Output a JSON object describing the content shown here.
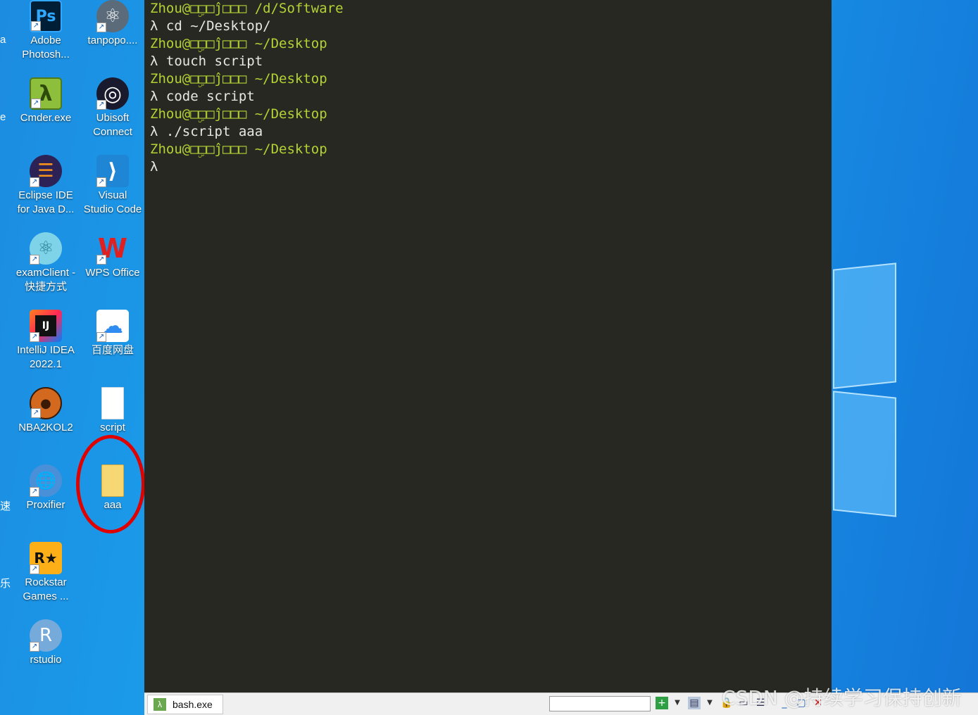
{
  "desktop": {
    "icons": [
      {
        "label": "Adobe\nPhotosh...",
        "icon": "photoshop-icon",
        "color": "#001e36",
        "glyph": "Ps"
      },
      {
        "label": "tanpopo....",
        "icon": "tanpopo-icon",
        "color": "#5b6b7a",
        "glyph": "⚛"
      },
      {
        "label": "Cmder.exe",
        "icon": "cmder-icon",
        "color": "#8dbf3c",
        "glyph": "λ"
      },
      {
        "label": "Ubisoft\nConnect",
        "icon": "ubisoft-icon",
        "color": "#1a1a2e",
        "glyph": "◎"
      },
      {
        "label": "Eclipse IDE\nfor Java D...",
        "icon": "eclipse-icon",
        "color": "#2c2255",
        "glyph": "☰"
      },
      {
        "label": "Visual\nStudio Code",
        "icon": "vscode-icon",
        "color": "#1f86d6",
        "glyph": "⟩"
      },
      {
        "label": "examClient -\n快捷方式",
        "icon": "examclient-icon",
        "color": "#7fd3e8",
        "glyph": "⚛"
      },
      {
        "label": "WPS Office",
        "icon": "wps-office-icon",
        "color": "#e02020",
        "glyph": "W"
      },
      {
        "label": "IntelliJ IDEA\n2022.1",
        "icon": "intellij-icon",
        "color": "#111",
        "glyph": "IJ"
      },
      {
        "label": "百度网盘",
        "icon": "baidu-netdisk-icon",
        "color": "#ffffff",
        "glyph": "☁"
      },
      {
        "label": "NBA2KOL2",
        "icon": "nba2kol2-icon",
        "color": "#d2691e",
        "glyph": "●"
      },
      {
        "label": "script",
        "icon": "blank-file-icon",
        "color": "#ffffff",
        "glyph": ""
      },
      {
        "label": "Proxifier",
        "icon": "proxifier-icon",
        "color": "#4a90d9",
        "glyph": "🌐"
      },
      {
        "label": "aaa",
        "icon": "folder-icon",
        "color": "#f6d774",
        "glyph": ""
      },
      {
        "label": "Rockstar\nGames ...",
        "icon": "rockstar-icon",
        "color": "#fcaf17",
        "glyph": "R★"
      },
      {
        "label": "rstudio",
        "icon": "rstudio-icon",
        "color": "#75aadb",
        "glyph": "R"
      }
    ],
    "edge_fragments": [
      "a",
      "e",
      "速",
      "乐"
    ]
  },
  "terminal": {
    "lines": [
      {
        "prompt": "Zhou@□ۣ□□ĵ□□□ /d/Software",
        "cmd": ""
      },
      {
        "prompt": "",
        "cmd": "λ cd ~/Desktop/"
      },
      {
        "prompt": "Zhou@□ۣ□□ĵ□□□ ~/Desktop",
        "cmd": ""
      },
      {
        "prompt": "",
        "cmd": "λ touch script"
      },
      {
        "prompt": "Zhou@□ۣ□□ĵ□□□ ~/Desktop",
        "cmd": ""
      },
      {
        "prompt": "",
        "cmd": "λ code script"
      },
      {
        "prompt": "Zhou@□ۣ□□ĵ□□□ ~/Desktop",
        "cmd": ""
      },
      {
        "prompt": "",
        "cmd": "λ ./script aaa"
      },
      {
        "prompt": "Zhou@□ۣ□□ĵ□□□ ~/Desktop",
        "cmd": ""
      },
      {
        "prompt": "",
        "cmd": "λ"
      }
    ]
  },
  "statusbar": {
    "tab_label": "bash.exe",
    "watermark": "CSDN @持续学习保持创新"
  },
  "colors": {
    "prompt": "#b3d234",
    "command": "#e8e8e2",
    "terminal_bg": "#272822",
    "highlight_circle": "#e00000"
  }
}
